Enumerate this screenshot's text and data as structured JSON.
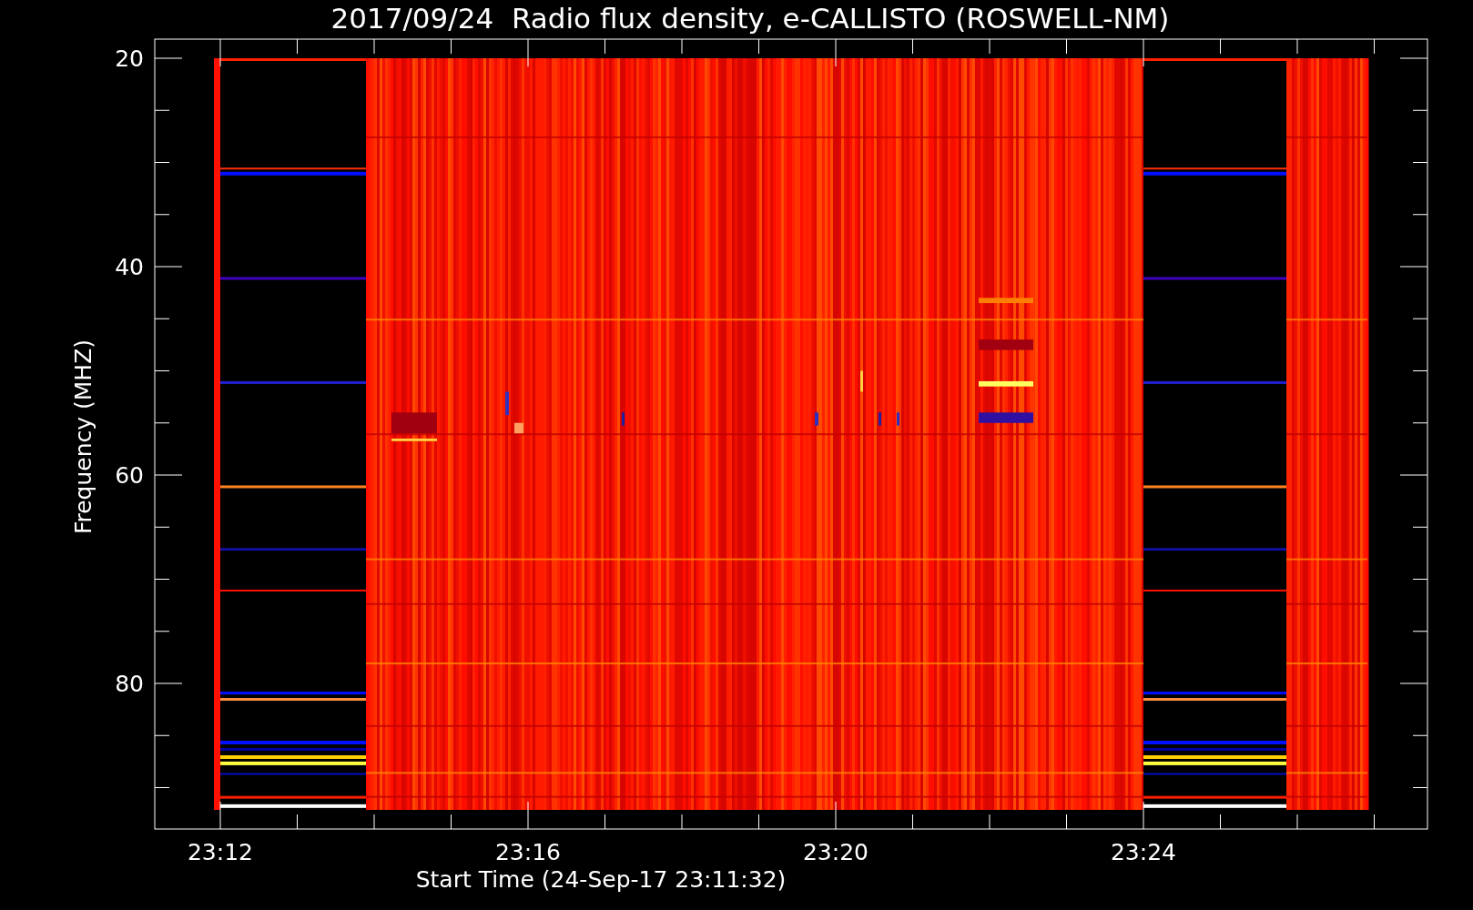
{
  "title": "2017/09/24  Radio flux density, e-CALLISTO (ROSWELL-NM)",
  "y_axis": {
    "label": "Frequency (MHZ)",
    "ticks": [
      "20",
      "40",
      "60",
      "80"
    ]
  },
  "x_axis": {
    "label": "Start Time (24-Sep-17 23:11:32)",
    "ticks": [
      "23:12",
      "23:16",
      "23:20",
      "23:24"
    ]
  }
}
